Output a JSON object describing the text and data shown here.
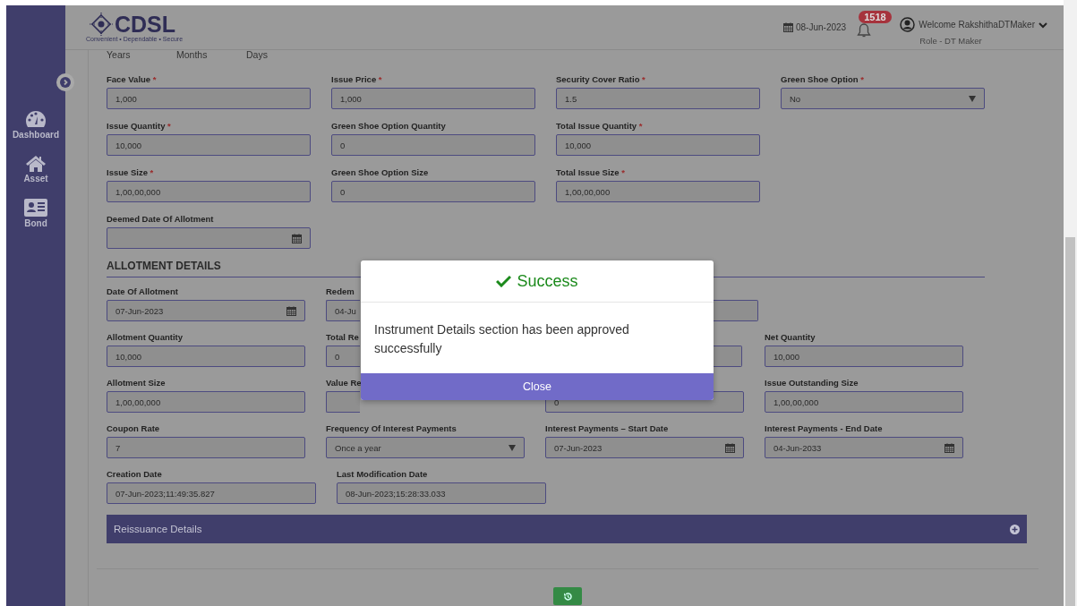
{
  "header": {
    "logo": {
      "name": "CDSL",
      "tagline": "Convenient • Dependable • Secure"
    },
    "date": "08-Jun-2023",
    "notifications": "1518",
    "user": {
      "welcome": "Welcome RakshithaDTMaker",
      "role": "Role - DT Maker"
    }
  },
  "sidebar": {
    "items": [
      {
        "label": "Dashboard",
        "kind": "gauge"
      },
      {
        "label": "Asset",
        "kind": "house"
      },
      {
        "label": "Bond",
        "kind": "card"
      }
    ]
  },
  "tenure_labels": [
    "Years",
    "Months",
    "Days"
  ],
  "instrument_rows": [
    [
      {
        "label": "Face Value",
        "required_mark": "*",
        "value": "1,000",
        "kind": "text"
      },
      {
        "label": "Issue Price",
        "required_mark": "*",
        "value": "1,000",
        "kind": "text"
      },
      {
        "label": "Security Cover Ratio",
        "required_mark": "*",
        "value": "1.5",
        "kind": "text"
      },
      {
        "label": "Green Shoe Option",
        "required_mark": "*",
        "value": "No",
        "kind": "select"
      }
    ],
    [
      {
        "label": "Issue Quantity",
        "required_mark": "*",
        "value": "10,000",
        "kind": "text"
      },
      {
        "label": "Green Shoe Option Quantity",
        "value": "0",
        "kind": "text"
      },
      {
        "label": "Total Issue Quantity",
        "required_mark": "*",
        "value": "10,000",
        "kind": "text"
      }
    ],
    [
      {
        "label": "Issue Size",
        "required_mark": "*",
        "value": "1,00,00,000",
        "kind": "text"
      },
      {
        "label": "Green Shoe Option Size",
        "value": "0",
        "kind": "text"
      },
      {
        "label": "Total Issue Size",
        "required_mark": "*",
        "value": "1,00,00,000",
        "kind": "text"
      }
    ],
    [
      {
        "label": "Deemed Date Of Allotment",
        "kind": "date"
      }
    ]
  ],
  "allotment": {
    "title": "ALLOTMENT DETAILS",
    "rows": [
      [
        {
          "label": "Date Of Allotment",
          "value": "07-Jun-2023",
          "kind": "date"
        },
        {
          "label": "Redem",
          "value": "04-Ju",
          "kind": "text"
        },
        {
          "kind": "text"
        }
      ],
      [
        {
          "label": "Allotment Quantity",
          "value": "10,000",
          "kind": "text"
        },
        {
          "label": "Total Re",
          "value": "0",
          "kind": "text"
        },
        {
          "kind": "text"
        },
        {
          "label": "Net Quantity",
          "value": "10,000",
          "kind": "text"
        }
      ],
      [
        {
          "label": "Allotment Size",
          "value": "1,00,00,000",
          "kind": "text"
        },
        {
          "label": "Value Re",
          "kind": "text"
        },
        {
          "value": "0",
          "kind": "text"
        },
        {
          "label": "Issue Outstanding Size",
          "value": "1,00,00,000",
          "kind": "text"
        }
      ],
      [
        {
          "label": "Coupon Rate",
          "value": "7",
          "kind": "text"
        },
        {
          "label": "Frequency Of Interest Payments",
          "value": "Once a year",
          "kind": "select"
        },
        {
          "label": "Interest Payments – Start Date",
          "value": "07-Jun-2023",
          "kind": "date"
        },
        {
          "label": "Interest Payments - End Date",
          "value": "04-Jun-2033",
          "kind": "date"
        }
      ]
    ]
  },
  "audit_fields": [
    {
      "label": "Creation Date",
      "value": "07-Jun-2023;11:49:35.827"
    },
    {
      "label": "Last Modification Date",
      "value": "08-Jun-2023;15:28:33.033"
    }
  ],
  "reissuance": {
    "title": "Reissuance Details",
    "expanded": false
  },
  "modal": {
    "title": "Success",
    "message": "Instrument Details section has been approved successfully",
    "close": "Close"
  }
}
